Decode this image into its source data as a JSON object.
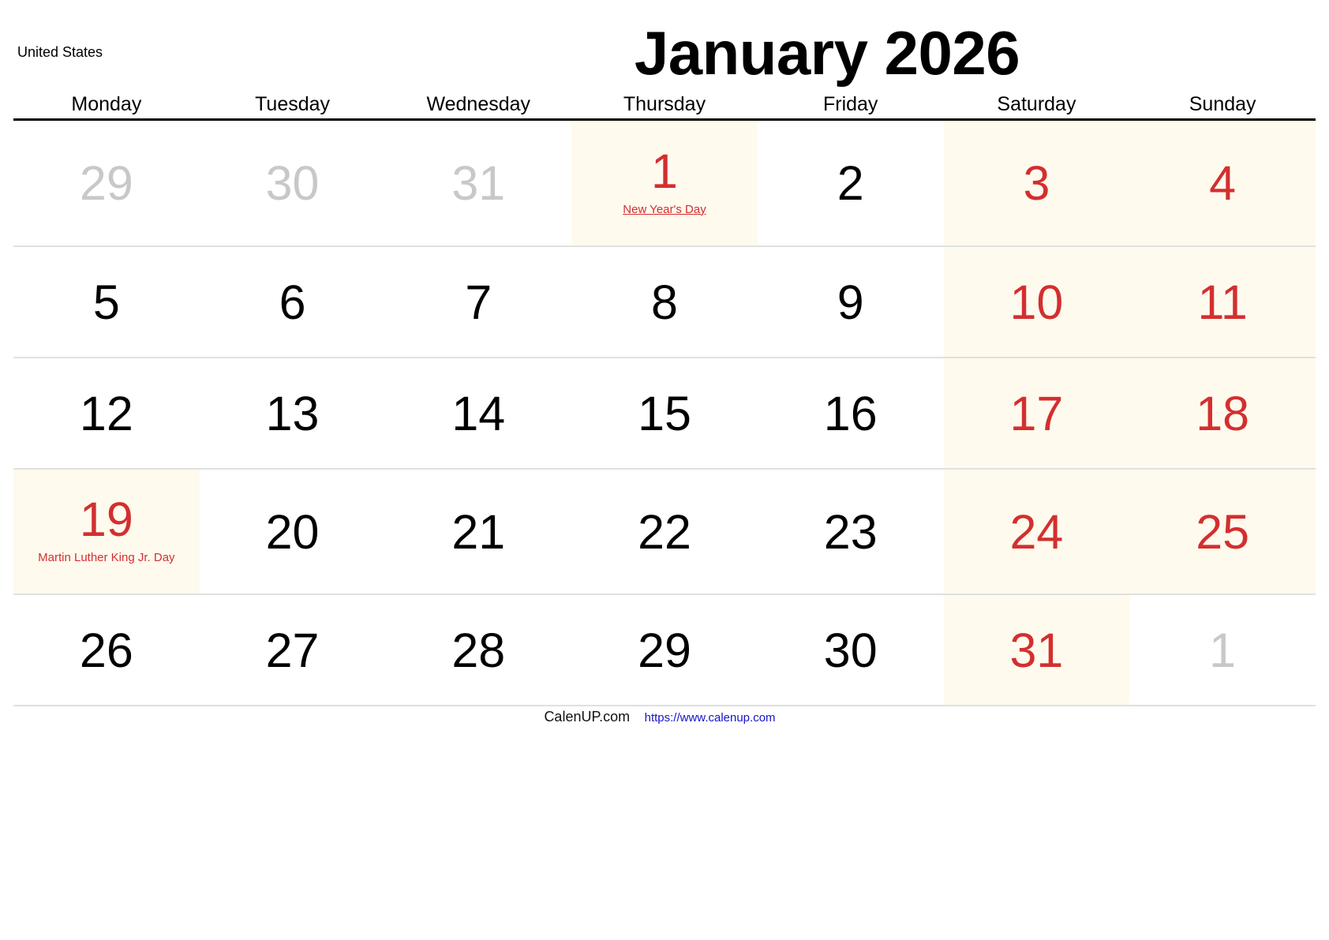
{
  "header": {
    "country": "United States",
    "title": "January 2026"
  },
  "weekdays": [
    "Monday",
    "Tuesday",
    "Wednesday",
    "Thursday",
    "Friday",
    "Saturday",
    "Sunday"
  ],
  "colors": {
    "weekend_text": "#d32f2f",
    "holiday_text": "#d32f2f",
    "other_month_text": "#c8c8c8",
    "shaded_bg": "#fffaee",
    "link": "#1414c8"
  },
  "weeks": [
    [
      {
        "day": "29",
        "type": "other"
      },
      {
        "day": "30",
        "type": "other"
      },
      {
        "day": "31",
        "type": "other"
      },
      {
        "day": "1",
        "type": "holiday",
        "holiday": "New Year's Day",
        "holiday_link": true
      },
      {
        "day": "2",
        "type": "normal"
      },
      {
        "day": "3",
        "type": "weekend"
      },
      {
        "day": "4",
        "type": "weekend"
      }
    ],
    [
      {
        "day": "5",
        "type": "normal"
      },
      {
        "day": "6",
        "type": "normal"
      },
      {
        "day": "7",
        "type": "normal"
      },
      {
        "day": "8",
        "type": "normal"
      },
      {
        "day": "9",
        "type": "normal"
      },
      {
        "day": "10",
        "type": "weekend"
      },
      {
        "day": "11",
        "type": "weekend"
      }
    ],
    [
      {
        "day": "12",
        "type": "normal"
      },
      {
        "day": "13",
        "type": "normal"
      },
      {
        "day": "14",
        "type": "normal"
      },
      {
        "day": "15",
        "type": "normal"
      },
      {
        "day": "16",
        "type": "normal"
      },
      {
        "day": "17",
        "type": "weekend"
      },
      {
        "day": "18",
        "type": "weekend"
      }
    ],
    [
      {
        "day": "19",
        "type": "holiday",
        "holiday": "Martin Luther King Jr. Day",
        "holiday_link": false
      },
      {
        "day": "20",
        "type": "normal"
      },
      {
        "day": "21",
        "type": "normal"
      },
      {
        "day": "22",
        "type": "normal"
      },
      {
        "day": "23",
        "type": "normal"
      },
      {
        "day": "24",
        "type": "weekend"
      },
      {
        "day": "25",
        "type": "weekend"
      }
    ],
    [
      {
        "day": "26",
        "type": "normal"
      },
      {
        "day": "27",
        "type": "normal"
      },
      {
        "day": "28",
        "type": "normal"
      },
      {
        "day": "29",
        "type": "normal"
      },
      {
        "day": "30",
        "type": "normal"
      },
      {
        "day": "31",
        "type": "weekend"
      },
      {
        "day": "1",
        "type": "other"
      }
    ]
  ],
  "footer": {
    "brand": "CalenUP.com",
    "url": "https://www.calenup.com"
  }
}
